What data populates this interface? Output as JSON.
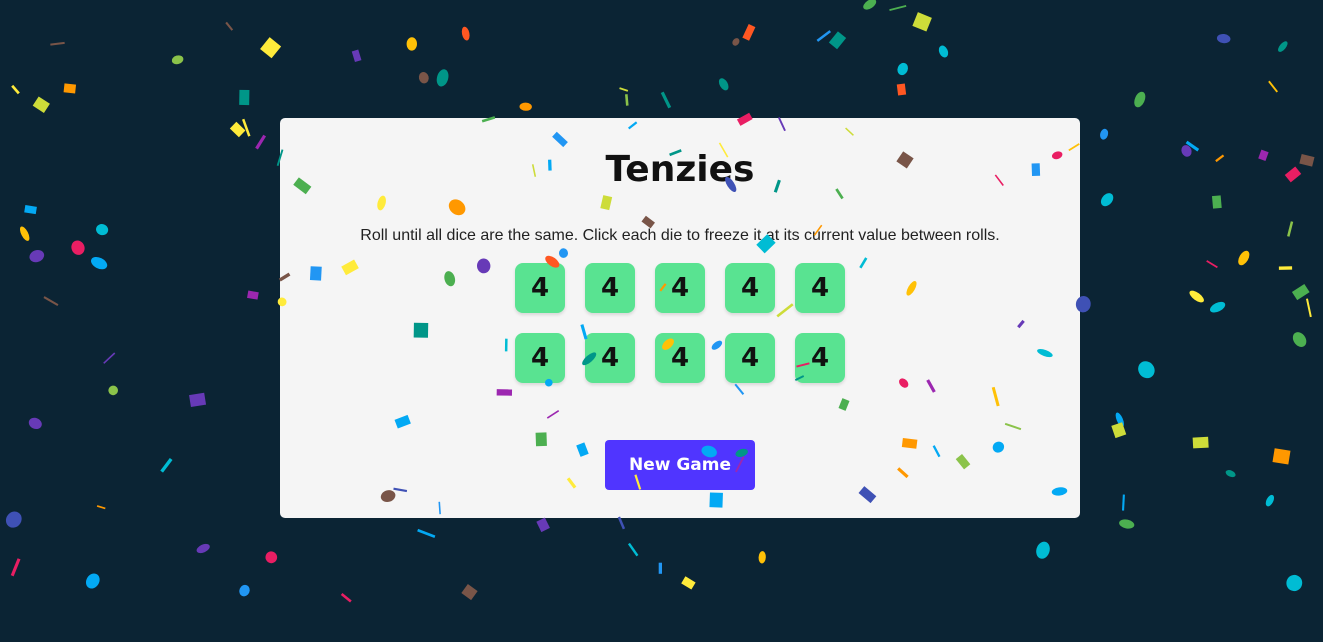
{
  "game": {
    "title": "Tenzies",
    "instructions": "Roll until all dice are the same. Click each die to freeze it at its current value between rolls.",
    "dice": [
      "4",
      "4",
      "4",
      "4",
      "4",
      "4",
      "4",
      "4",
      "4",
      "4"
    ],
    "new_game_label": "New Game"
  },
  "colors": {
    "background": "#0b2434",
    "panel": "#f5f5f5",
    "die": "#59e391",
    "button": "#5035ff",
    "confetti": [
      "#e91e63",
      "#9c27b0",
      "#673ab7",
      "#3f51b5",
      "#2196f3",
      "#03a9f4",
      "#00bcd4",
      "#009688",
      "#4caf50",
      "#8bc34a",
      "#cddc39",
      "#ffeb3b",
      "#ffc107",
      "#ff9800",
      "#ff5722",
      "#795548"
    ]
  }
}
